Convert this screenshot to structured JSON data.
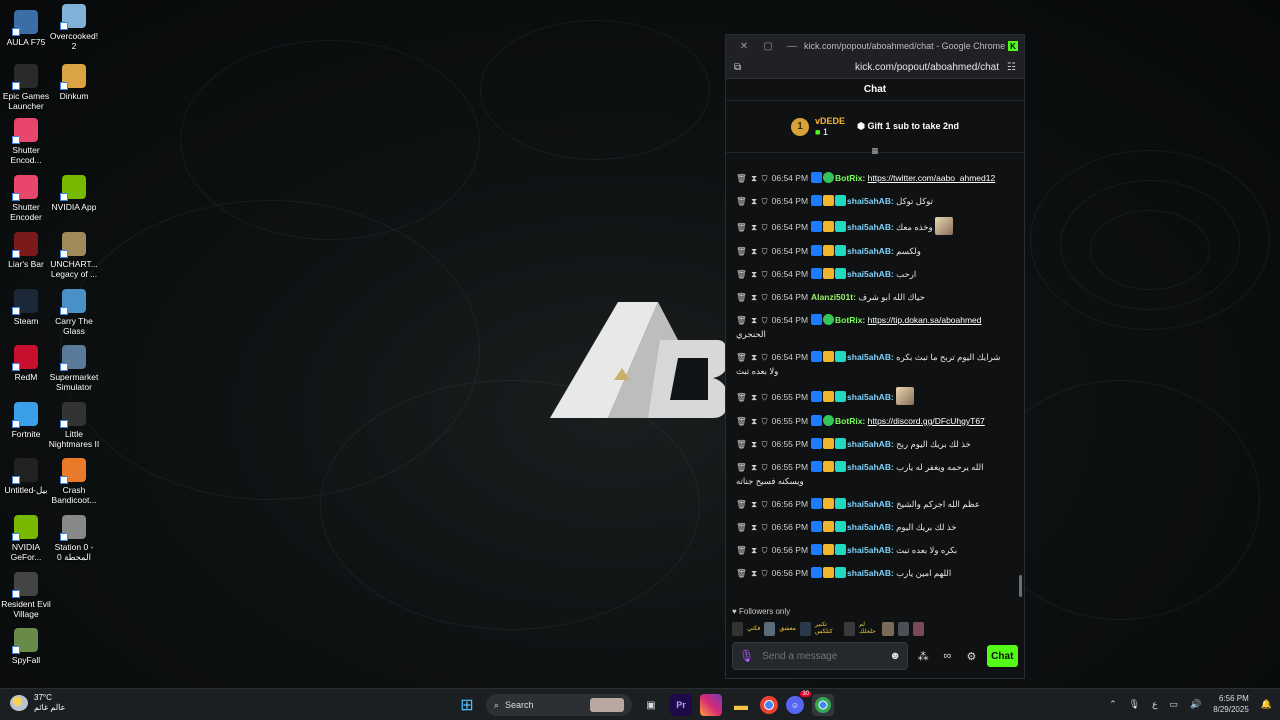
{
  "desktop_icons": [
    {
      "label": "AULA F75",
      "icon": "keyboard-icon",
      "color": "#3a6ea5"
    },
    {
      "label": "Overcooked! 2",
      "icon": "game-icon",
      "color": "#7fb2d6"
    },
    {
      "label": "Epic Games Launcher",
      "icon": "epic-icon",
      "color": "#2a2a2a"
    },
    {
      "label": "Dinkum",
      "icon": "dinkum-icon",
      "color": "#d9a441"
    },
    {
      "label": "Shutter Encod...",
      "icon": "shutter-icon",
      "color": "#e8476b"
    },
    {
      "label": "Shutter Encoder",
      "icon": "shutter-icon",
      "color": "#e8476b"
    },
    {
      "label": "NVIDIA App",
      "icon": "nvidia-icon",
      "color": "#76b900"
    },
    {
      "label": "Liar's Bar",
      "icon": "game-icon",
      "color": "#7a1a1a"
    },
    {
      "label": "UNCHART... Legacy of ...",
      "icon": "game-icon",
      "color": "#a08a5a"
    },
    {
      "label": "Steam",
      "icon": "steam-icon",
      "color": "#1b2838"
    },
    {
      "label": "Carry The Glass",
      "icon": "game-icon",
      "color": "#4a90c8"
    },
    {
      "label": "RedM",
      "icon": "redm-icon",
      "color": "#c8102e"
    },
    {
      "label": "Supermarket Simulator",
      "icon": "game-icon",
      "color": "#5a7a9a"
    },
    {
      "label": "Fortnite",
      "icon": "fortnite-icon",
      "color": "#3aa0e8"
    },
    {
      "label": "Little Nightmares II",
      "icon": "game-icon",
      "color": "#333"
    },
    {
      "label": "Untitled-بيل",
      "icon": "file-icon",
      "color": "#222"
    },
    {
      "label": "Crash Bandicoot...",
      "icon": "game-icon",
      "color": "#e87a2a"
    },
    {
      "label": "NVIDIA GeFor...",
      "icon": "nvidia-icon",
      "color": "#76b900"
    },
    {
      "label": "Station 0 - المحطة 0",
      "icon": "game-icon",
      "color": "#888"
    },
    {
      "label": "Resident Evil Village",
      "icon": "game-icon",
      "color": "#444"
    },
    {
      "label": "SpyFall",
      "icon": "game-icon",
      "color": "#6a8a4a"
    }
  ],
  "window": {
    "title": "kick.com/popout/aboahmed/chat - Google Chrome",
    "url": "kick.com/popout/aboahmed/chat",
    "chat_header": "Chat"
  },
  "pinned": {
    "rank": "1",
    "username": "vDEDE",
    "count": "1",
    "gift_text": "Gift 1 sub to take 2nd"
  },
  "messages": [
    {
      "time": "06:54 PM",
      "user": "BotRix",
      "type": "bot",
      "text": "",
      "link": "https://twitter.com/aabo_ahmed12"
    },
    {
      "time": "06:54 PM",
      "user": "shai5ahAB",
      "type": "shai",
      "text": "توكل توكل"
    },
    {
      "time": "06:54 PM",
      "user": "shai5ahAB",
      "type": "shai",
      "text": "وخذه معك",
      "emote": true
    },
    {
      "time": "06:54 PM",
      "user": "shai5ahAB",
      "type": "shai",
      "text": "ولكسم"
    },
    {
      "time": "06:54 PM",
      "user": "shai5ahAB",
      "type": "shai",
      "text": "ارحب"
    },
    {
      "time": "06:54 PM",
      "user": "Alanzi501t",
      "type": "al",
      "text": "حياك الله ابو شرف"
    },
    {
      "time": "06:54 PM",
      "user": "BotRix",
      "type": "bot",
      "text": "الحنجري",
      "link": "https://tip.dokan.sa/aboahmed"
    },
    {
      "time": "06:54 PM",
      "user": "shai5ahAB",
      "type": "shai",
      "text": "شرايك اليوم تربح ما تبث بكره ولا بعده تبث"
    },
    {
      "time": "06:55 PM",
      "user": "shai5ahAB",
      "type": "shai",
      "text": "",
      "emote": true
    },
    {
      "time": "06:55 PM",
      "user": "BotRix",
      "type": "bot",
      "text": "",
      "link": "https://discord.gg/DFcUhgyT67"
    },
    {
      "time": "06:55 PM",
      "user": "shai5ahAB",
      "type": "shai",
      "text": "خذ لك بريك اليوم ربح"
    },
    {
      "time": "06:55 PM",
      "user": "shai5ahAB",
      "type": "shai",
      "text": "الله يرحمه ويغفر له يارب ويسكنه فسيح جناته"
    },
    {
      "time": "06:56 PM",
      "user": "shai5ahAB",
      "type": "shai",
      "text": "عظم الله اجركم والشيخ"
    },
    {
      "time": "06:56 PM",
      "user": "shai5ahAB",
      "type": "shai",
      "text": "خذ لك بريك اليوم"
    },
    {
      "time": "06:56 PM",
      "user": "shai5ahAB",
      "type": "shai",
      "text": "بكره ولا بعده تبث"
    },
    {
      "time": "06:56 PM",
      "user": "shai5ahAB",
      "type": "shai",
      "text": "اللهم امين يارب"
    }
  ],
  "followers_label": "Followers only",
  "emote_strip_text": [
    "فكتي",
    "معشق",
    "تكبير كتلكس",
    "لم حلجلك"
  ],
  "composer": {
    "placeholder": "Send a message",
    "send_label": "Chat"
  },
  "taskbar": {
    "temperature": "37°C",
    "weather_text": "عالم غائم",
    "search_label": "Search",
    "lang": "ع",
    "time": "6:56 PM",
    "date": "8/29/2025",
    "discord_badge": "30"
  }
}
